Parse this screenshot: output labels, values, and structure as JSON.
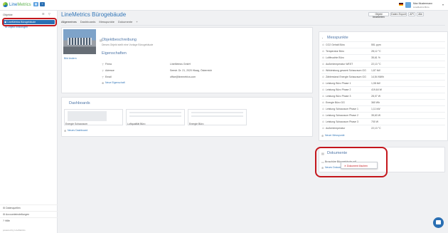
{
  "app": {
    "logo_text_1": "Line",
    "logo_text_2": "Metrics"
  },
  "user": {
    "name": "Max Mustermann",
    "company": "LineMetrics Büro"
  },
  "sidebar": {
    "header": "Objekte",
    "active_item": "LineMetrics Bürogebäude",
    "sub_item": "Objekt hinzufügen",
    "footer": [
      "Datenquellen",
      "Accounteinstellungen",
      "Hilfe"
    ],
    "powered": "powered by LineMetrics"
  },
  "page": {
    "title": "LineMetrics Bürogebäude",
    "tabs": [
      "Allgemeines",
      "Dashboards",
      "Messpunkte",
      "Dokumente",
      "+"
    ],
    "buttons": [
      "Objekt bearbeiten",
      "Daten Export",
      "API",
      "Alle"
    ]
  },
  "object": {
    "desc_title": "Objektbeschreibung",
    "desc_text": "Dieses Objekt stellt eine Vorlage Bürogebäude",
    "props_title": "Eigenschaften",
    "image_link": "Bild ändern",
    "properties": [
      {
        "name": "Firma",
        "value": "LineMetrics GmbH"
      },
      {
        "name": "Adresse",
        "value": "Seestr. Dr. 21, 2020 Hlaag, Österreich"
      },
      {
        "name": "Email",
        "value": "office@linemetrics.com"
      }
    ],
    "add_property": "Neue Eigenschaft"
  },
  "dashboards": {
    "title": "Dashboards",
    "items": [
      "Energie Schauraum",
      "Luftqualität Büro",
      "Energie Büro"
    ],
    "add": "Neues Dashboard"
  },
  "messpunkte": {
    "title": "Messpunkte",
    "rows": [
      {
        "name": "CO2 Gehalt Büro",
        "value": "551 ppm"
      },
      {
        "name": "Temperatur Büro",
        "value": "28,12 °C"
      },
      {
        "name": "Luftfeuchte Büro",
        "value": "35,61 %"
      },
      {
        "name": "Außentemperatur WEST",
        "value": "22,13 °C"
      },
      {
        "name": "Wirkleistung gesamt Schauraum GG",
        "value": "1,87 kW"
      },
      {
        "name": "Zählerstand Energie Schauraum GG",
        "value": "14,54 MWh"
      },
      {
        "name": "Leistung Büro Phase 1",
        "value": "1,08 kW"
      },
      {
        "name": "Leistung Büro Phase 2",
        "value": "419,64 W"
      },
      {
        "name": "Leistung Büro Phase 3",
        "value": "28,07 W"
      },
      {
        "name": "Energie Büro GG",
        "value": "360 Wh"
      },
      {
        "name": "Leistung Schauraum Phase 1",
        "value": "1,11 kW"
      },
      {
        "name": "Leistung Schauraum Phase 2",
        "value": "35,63 W"
      },
      {
        "name": "Leistung Schauraum Phase 3",
        "value": "700 W"
      },
      {
        "name": "Außentemperatur",
        "value": "22,13 °C"
      }
    ],
    "add": "Neuer Messpunkt"
  },
  "dokumente": {
    "title": "Dokumente",
    "file": "Broschüre Bürogebäude.pdf",
    "add": "Neues Dokument",
    "context_delete": "Dokument löschen"
  }
}
